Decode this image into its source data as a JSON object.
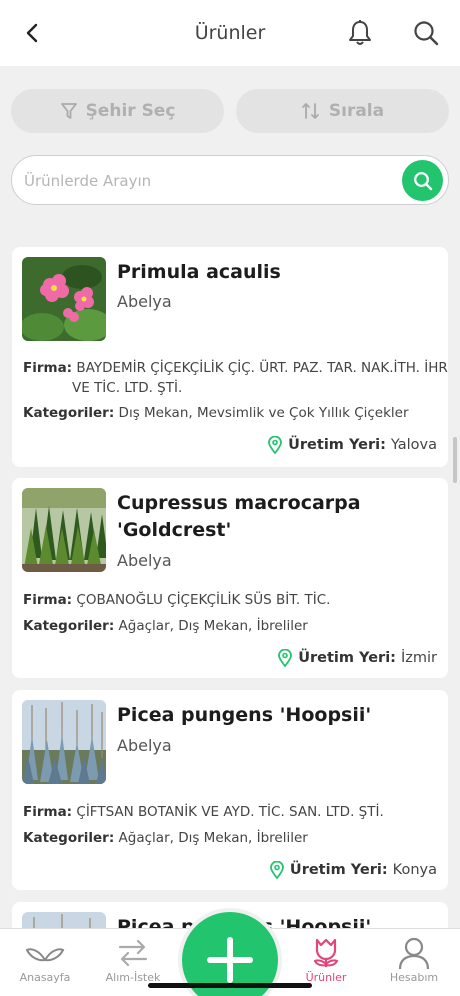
{
  "header": {
    "title": "Ürünler",
    "back_icon": "chevron-left-icon",
    "bell_icon": "bell-icon",
    "search_icon": "search-icon"
  },
  "filters": {
    "city_label": "Şehir Seç",
    "sort_label": "Sırala"
  },
  "search": {
    "placeholder": "Ürünlerde Arayın",
    "value": ""
  },
  "labels": {
    "firma": "Firma:",
    "kategoriler": "Kategoriler:",
    "uretim_yeri": "Üretim Yeri:"
  },
  "products": [
    {
      "name": "Primula acaulis",
      "seller": "Abelya",
      "firma_line1": "BAYDEMİR ÇİÇEKÇİLİK ÇİÇ. ÜRT. PAZ. TAR. NAK.İTH. İHR. SAN",
      "firma_line2": "VE TİC. LTD. ŞTİ.",
      "kategoriler": "Dış Mekan, Mevsimlik ve Çok Yıllık Çiçekler",
      "uretim_yeri": "Yalova"
    },
    {
      "name": "Cupressus macrocarpa 'Goldcrest'",
      "seller": "Abelya",
      "firma": "ÇOBANOĞLU ÇİÇEKÇİLİK SÜS BİT. TİC.",
      "kategoriler": "Ağaçlar, Dış Mekan, İbreliler",
      "uretim_yeri": "İzmir"
    },
    {
      "name": "Picea pungens 'Hoopsii'",
      "seller": "Abelya",
      "firma": "ÇİFTSAN BOTANİK VE AYD. TİC. SAN. LTD. ŞTİ.",
      "kategoriler": "Ağaçlar, Dış Mekan, İbreliler",
      "uretim_yeri": "Konya"
    },
    {
      "name": "Picea pungens 'Hoopsii'"
    }
  ],
  "tabbar": {
    "home": "Anasayfa",
    "trade": "Alım-İstek",
    "products": "Ürünler",
    "account": "Hesabım",
    "active_color": "#e0457b",
    "accent": "#22c56e"
  }
}
